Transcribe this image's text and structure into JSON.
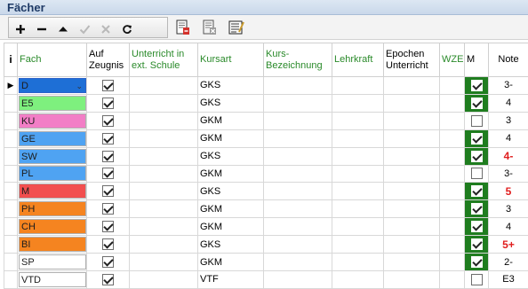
{
  "panel": {
    "title": "Fächer"
  },
  "toolbar": {
    "buttons": [
      {
        "name": "add-button",
        "icon": "plus-icon"
      },
      {
        "name": "remove-button",
        "icon": "minus-icon"
      },
      {
        "name": "move-up-button",
        "icon": "arrow-up-icon"
      },
      {
        "name": "confirm-button",
        "icon": "check-icon"
      },
      {
        "name": "cancel-button",
        "icon": "x-icon"
      },
      {
        "name": "refresh-button",
        "icon": "refresh-icon"
      },
      {
        "name": "import-button",
        "icon": "document-import-icon"
      },
      {
        "name": "export-button",
        "icon": "document-export-icon"
      },
      {
        "name": "edit-list-button",
        "icon": "edit-list-icon"
      }
    ]
  },
  "grid": {
    "headers": {
      "info": "i",
      "fach": "Fach",
      "auf_zeugnis": "Auf Zeugnis",
      "unterricht_ext": "Unterricht in ext. Schule",
      "kursart": "Kursart",
      "kurs_bezeichnung": "Kurs-Bezeichnung",
      "lehrkraft": "Lehrkraft",
      "epochen": "Epochen Unterricht",
      "wze": "WZE",
      "m": "M",
      "note": "Note"
    },
    "rows": [
      {
        "fach": "D",
        "color": "#1e6fd6",
        "zeugnis": true,
        "kursart": "GKS",
        "m": true,
        "note": "3-",
        "note_red": false,
        "active": true
      },
      {
        "fach": "E5",
        "color": "#7ef07e",
        "zeugnis": true,
        "kursart": "GKS",
        "m": true,
        "note": "4",
        "note_red": false
      },
      {
        "fach": "KU",
        "color": "#f27ec6",
        "zeugnis": true,
        "kursart": "GKM",
        "m": false,
        "note": "3",
        "note_red": false
      },
      {
        "fach": "GE",
        "color": "#4fa3f2",
        "zeugnis": true,
        "kursart": "GKM",
        "m": true,
        "note": "4",
        "note_red": false
      },
      {
        "fach": "SW",
        "color": "#4fa3f2",
        "zeugnis": true,
        "kursart": "GKS",
        "m": true,
        "note": "4-",
        "note_red": true
      },
      {
        "fach": "PL",
        "color": "#4fa3f2",
        "zeugnis": true,
        "kursart": "GKM",
        "m": false,
        "note": "3-",
        "note_red": false
      },
      {
        "fach": "M",
        "color": "#f24f4f",
        "zeugnis": true,
        "kursart": "GKS",
        "m": true,
        "note": "5",
        "note_red": true
      },
      {
        "fach": "PH",
        "color": "#f58420",
        "zeugnis": true,
        "kursart": "GKM",
        "m": true,
        "note": "3",
        "note_red": false
      },
      {
        "fach": "CH",
        "color": "#f58420",
        "zeugnis": true,
        "kursart": "GKM",
        "m": true,
        "note": "4",
        "note_red": false
      },
      {
        "fach": "BI",
        "color": "#f58420",
        "zeugnis": true,
        "kursart": "GKS",
        "m": true,
        "note": "5+",
        "note_red": true
      },
      {
        "fach": "SP",
        "color": "#ffffff",
        "zeugnis": true,
        "kursart": "GKM",
        "m": true,
        "note": "2-",
        "note_red": false
      },
      {
        "fach": "VTD",
        "color": "#ffffff",
        "zeugnis": true,
        "kursart": "VTF",
        "m": false,
        "note": "E3",
        "note_red": false
      }
    ]
  }
}
